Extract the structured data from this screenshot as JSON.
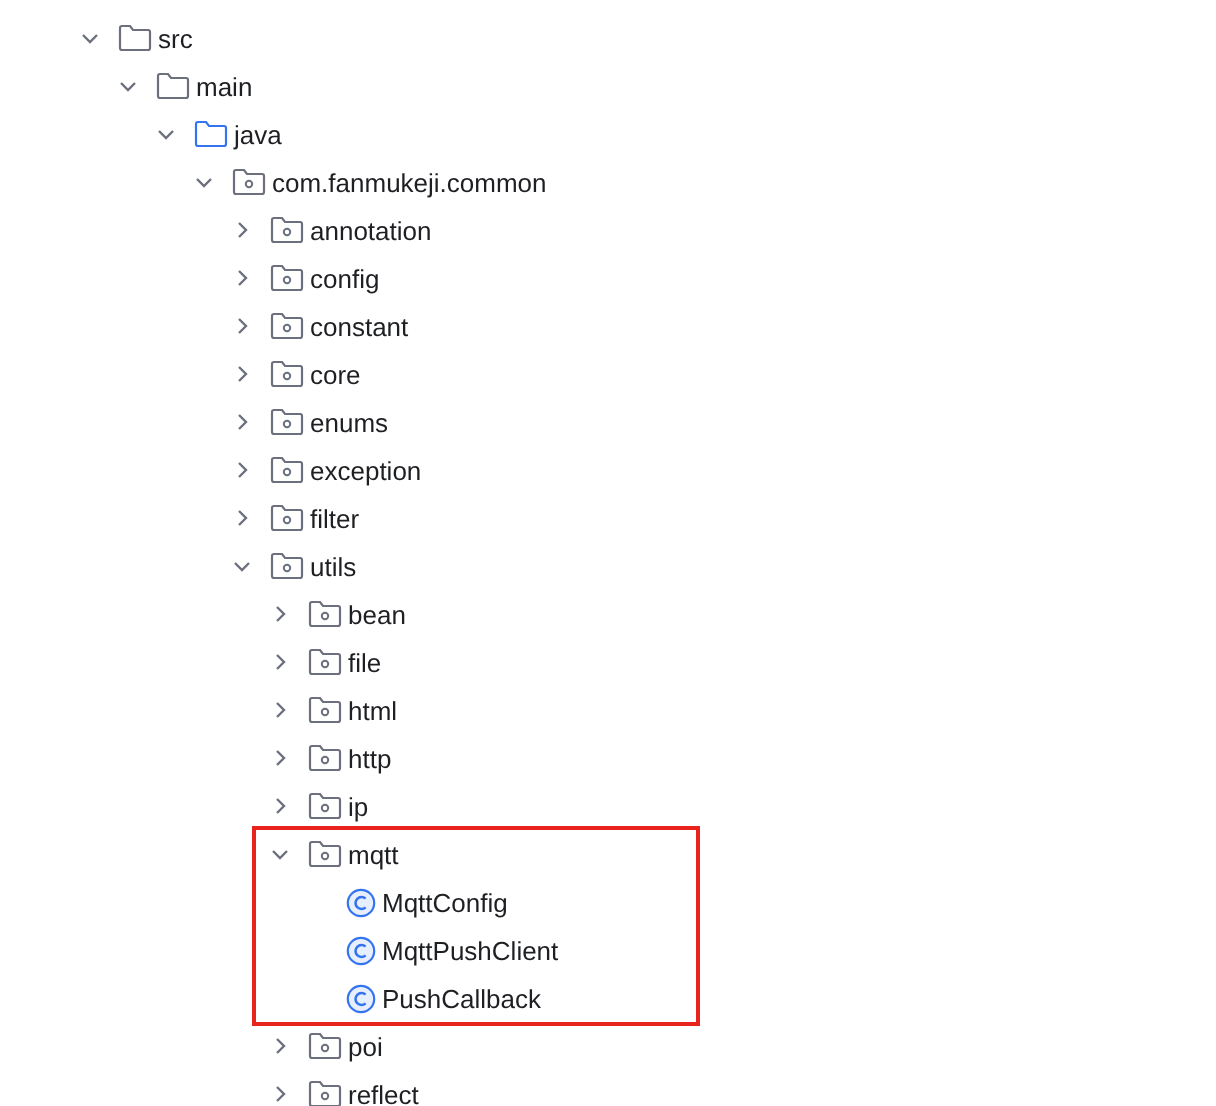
{
  "tree": [
    {
      "label": "src",
      "kind": "folder",
      "expanded": true,
      "highlighted": false,
      "children": [
        {
          "label": "main",
          "kind": "folder",
          "expanded": true,
          "highlighted": false,
          "children": [
            {
              "label": "java",
              "kind": "source_root",
              "expanded": true,
              "highlighted": false,
              "children": [
                {
                  "label": "com.fanmukeji.common",
                  "kind": "package",
                  "expanded": true,
                  "highlighted": false,
                  "children": [
                    {
                      "label": "annotation",
                      "kind": "package",
                      "expanded": false,
                      "highlighted": false
                    },
                    {
                      "label": "config",
                      "kind": "package",
                      "expanded": false,
                      "highlighted": false
                    },
                    {
                      "label": "constant",
                      "kind": "package",
                      "expanded": false,
                      "highlighted": false
                    },
                    {
                      "label": "core",
                      "kind": "package",
                      "expanded": false,
                      "highlighted": false
                    },
                    {
                      "label": "enums",
                      "kind": "package",
                      "expanded": false,
                      "highlighted": false
                    },
                    {
                      "label": "exception",
                      "kind": "package",
                      "expanded": false,
                      "highlighted": false
                    },
                    {
                      "label": "filter",
                      "kind": "package",
                      "expanded": false,
                      "highlighted": false
                    },
                    {
                      "label": "utils",
                      "kind": "package",
                      "expanded": true,
                      "highlighted": false,
                      "children": [
                        {
                          "label": "bean",
                          "kind": "package",
                          "expanded": false,
                          "highlighted": false
                        },
                        {
                          "label": "file",
                          "kind": "package",
                          "expanded": false,
                          "highlighted": false
                        },
                        {
                          "label": "html",
                          "kind": "package",
                          "expanded": false,
                          "highlighted": false
                        },
                        {
                          "label": "http",
                          "kind": "package",
                          "expanded": false,
                          "highlighted": false
                        },
                        {
                          "label": "ip",
                          "kind": "package",
                          "expanded": false,
                          "highlighted": false
                        },
                        {
                          "label": "mqtt",
                          "kind": "package",
                          "expanded": true,
                          "highlighted": true,
                          "children": [
                            {
                              "label": "MqttConfig",
                              "kind": "class",
                              "highlighted": false
                            },
                            {
                              "label": "MqttPushClient",
                              "kind": "class",
                              "highlighted": false
                            },
                            {
                              "label": "PushCallback",
                              "kind": "class",
                              "highlighted": false
                            }
                          ]
                        },
                        {
                          "label": "poi",
                          "kind": "package",
                          "expanded": false,
                          "highlighted": false
                        },
                        {
                          "label": "reflect",
                          "kind": "package",
                          "expanded": false,
                          "highlighted": false
                        }
                      ]
                    }
                  ]
                }
              ]
            }
          ]
        }
      ]
    }
  ]
}
